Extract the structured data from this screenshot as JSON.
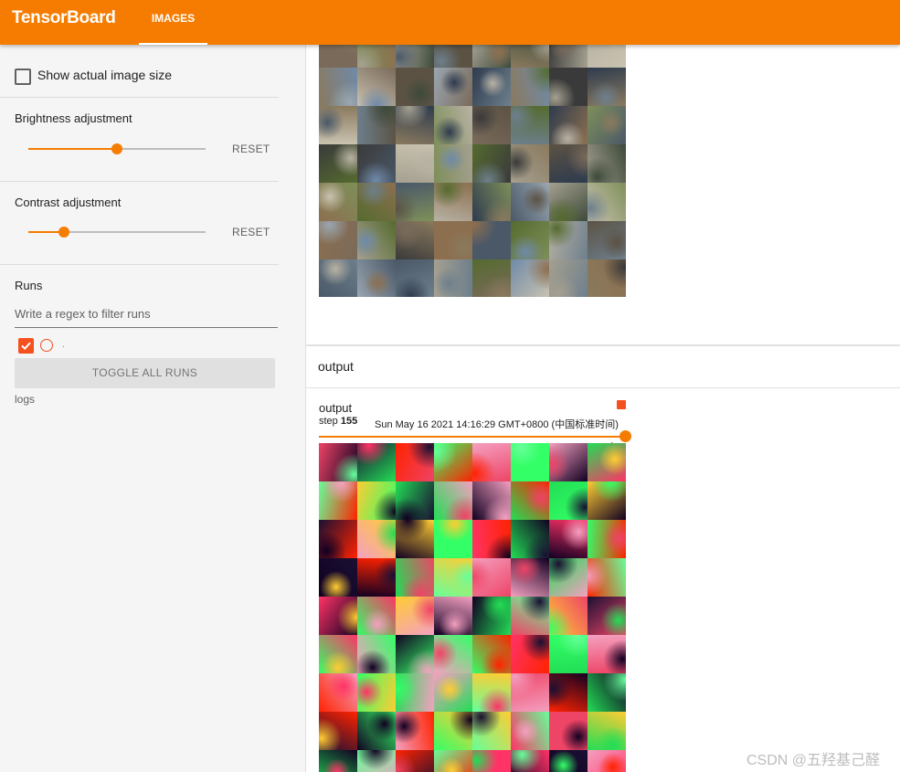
{
  "header": {
    "brand": "TensorBoard",
    "active_tab": "IMAGES"
  },
  "sidebar": {
    "show_actual_size_label": "Show actual image size",
    "show_actual_size_checked": false,
    "brightness": {
      "title": "Brightness adjustment",
      "value": 0.5,
      "reset_label": "RESET"
    },
    "contrast": {
      "title": "Contrast adjustment",
      "value": 0.2,
      "reset_label": "RESET"
    },
    "runs": {
      "title": "Runs",
      "filter_placeholder": "Write a regex to filter runs",
      "run_name": ".",
      "run_checked": true,
      "toggle_label": "TOGGLE ALL RUNS",
      "log_dir": "logs"
    }
  },
  "main": {
    "group_label": "output",
    "image_card": {
      "title": "output",
      "step_label": "step",
      "step_value": "155",
      "timestamp": "Sun May 16 2021 14:16:29 GMT+0800 (中国标准时间)",
      "step_slider_value": 1.0
    }
  },
  "colors": {
    "accent": "#f57c00",
    "run_color": "#f4511e"
  },
  "icons": {
    "expand": "expand-icon",
    "check": "check-icon",
    "run_color": "circle-icon"
  },
  "watermark": "CSDN @五羟基己醛"
}
